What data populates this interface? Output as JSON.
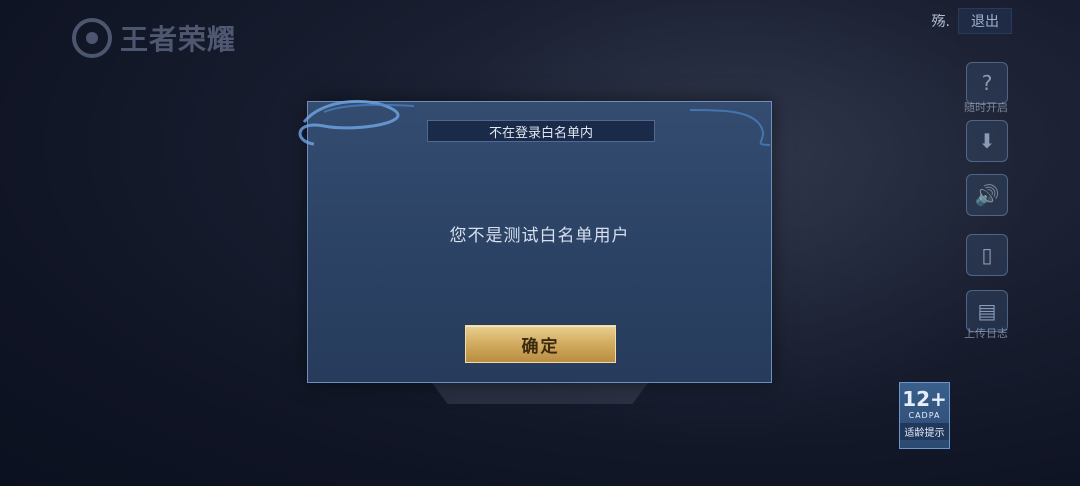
{
  "logo": {
    "text": "王者荣耀"
  },
  "header": {
    "user_name": "殇.",
    "logout_label": "退出"
  },
  "side_menu": [
    {
      "icon": "help-icon",
      "glyph": "?",
      "label": "随时开启"
    },
    {
      "icon": "download-icon",
      "glyph": "⬇",
      "label": ""
    },
    {
      "icon": "speaker-icon",
      "glyph": "🔊",
      "label": ""
    },
    {
      "icon": "phone-icon",
      "glyph": "▯",
      "label": ""
    },
    {
      "icon": "log-icon",
      "glyph": "▤",
      "label": "上传日志"
    }
  ],
  "age_rating": {
    "number": "12+",
    "org": "CADPA",
    "label": "适龄提示"
  },
  "dialog": {
    "title": "不在登录白名单内",
    "message": "您不是测试白名单用户",
    "confirm_label": "确定"
  },
  "colors": {
    "accent_gold": "#cfa85b",
    "dialog_bg": "#2b4264"
  }
}
